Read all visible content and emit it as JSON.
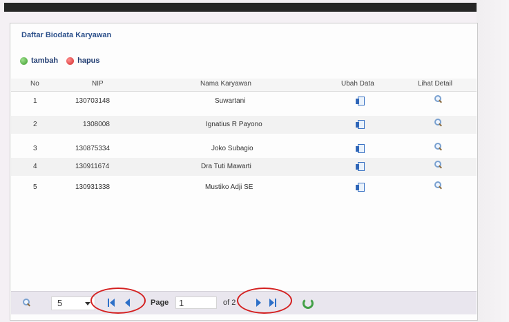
{
  "panel": {
    "title": "Daftar Biodata Karyawan"
  },
  "toolbar": {
    "add_label": "tambah",
    "delete_label": "hapus"
  },
  "table": {
    "headers": {
      "no": "No",
      "nip": "NIP",
      "nama": "Nama Karyawan",
      "ubah": "Ubah Data",
      "detail": "Lihat Detail"
    },
    "rows": [
      {
        "no": "1",
        "nip": "130703148",
        "nama": "Suwartani"
      },
      {
        "no": "2",
        "nip": "1308008",
        "nama": "Ignatius R Payono"
      },
      {
        "no": "3",
        "nip": "130875334",
        "nama": "Joko Subagio"
      },
      {
        "no": "4",
        "nip": "130911674",
        "nama": "Dra Tuti Mawarti"
      },
      {
        "no": "5",
        "nip": "130931338",
        "nama": "Mustiko Adji SE"
      }
    ]
  },
  "pager": {
    "page_size": "5",
    "page_label": "Page",
    "current_page": "1",
    "of_label": "of 2"
  },
  "accent": {
    "header_title": "#2b4f8a",
    "nav_blue": "#2e70c8",
    "refresh_green": "#43a047",
    "highlight_ring": "#d42020"
  }
}
